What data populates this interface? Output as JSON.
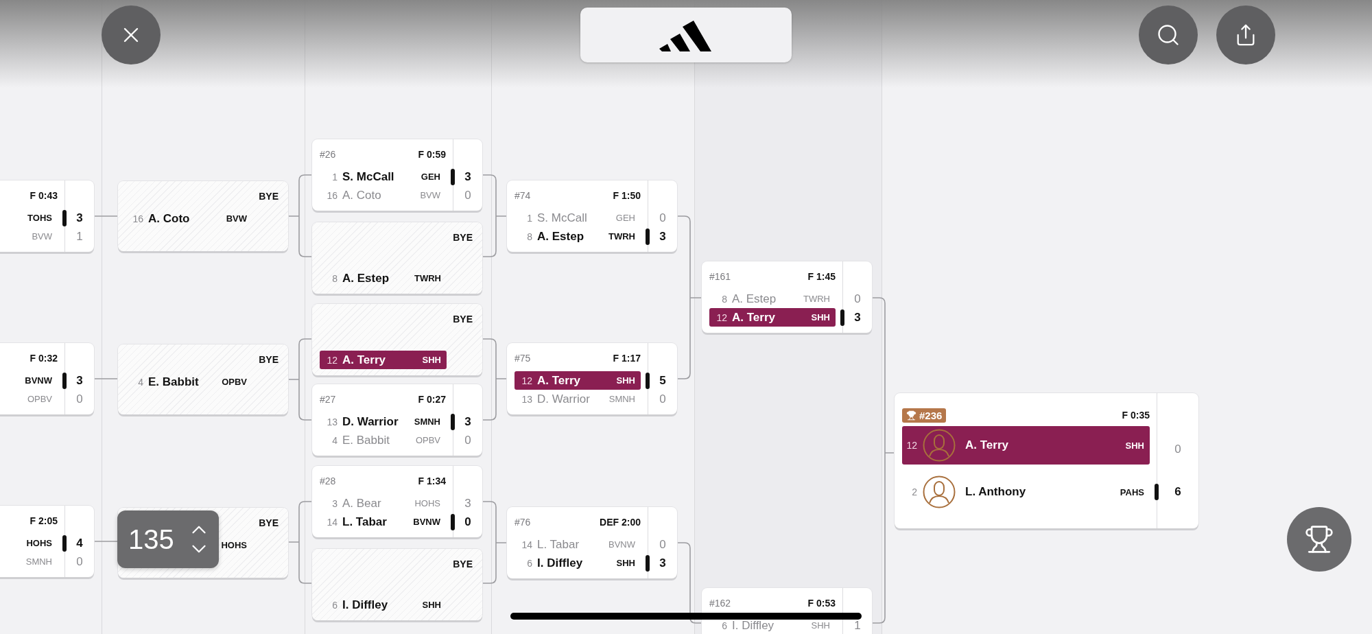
{
  "rounds": [
    {
      "matches": [
        {
          "kind": "match",
          "result": "F 0:43",
          "players": [
            {
              "team": "TOHS",
              "score": "3",
              "winner": true,
              "highlighted": false
            },
            {
              "team": "BVW",
              "score": "1",
              "winner": false,
              "highlighted": false
            }
          ]
        },
        {
          "kind": "match",
          "result": "F 0:32",
          "players": [
            {
              "team": "BVNW",
              "score": "3",
              "winner": true,
              "highlighted": false
            },
            {
              "team": "OPBV",
              "score": "0",
              "winner": false,
              "highlighted": false
            }
          ]
        },
        {
          "kind": "match",
          "result": "F 2:05",
          "players": [
            {
              "team": "HOHS",
              "score": "4",
              "winner": true,
              "highlighted": false
            },
            {
              "team": "SMNH",
              "score": "0",
              "winner": false,
              "highlighted": false
            }
          ]
        }
      ]
    },
    {
      "matches": [
        {
          "kind": "bye",
          "label": "BYE",
          "players": [
            {
              "seed": "16",
              "name": "A. Coto",
              "team": "BVW",
              "highlighted": false
            }
          ]
        },
        {
          "kind": "bye",
          "label": "BYE",
          "players": [
            {
              "seed": "4",
              "name": "E. Babbit",
              "team": "OPBV",
              "highlighted": false
            }
          ]
        },
        {
          "kind": "bye",
          "label": "BYE",
          "players": [
            {
              "team": "HOHS",
              "highlighted": false
            }
          ]
        }
      ]
    },
    {
      "matches": [
        {
          "kind": "match",
          "number": "#26",
          "result": "F 0:59",
          "players": [
            {
              "seed": "1",
              "name": "S. McCall",
              "team": "GEH",
              "score": "3",
              "winner": true,
              "highlighted": false
            },
            {
              "seed": "16",
              "name": "A. Coto",
              "team": "BVW",
              "score": "0",
              "winner": false,
              "highlighted": false
            }
          ]
        },
        {
          "kind": "bye",
          "label": "BYE",
          "players": [
            {
              "seed": "8",
              "name": "A. Estep",
              "team": "TWRH",
              "highlighted": false
            }
          ]
        },
        {
          "kind": "bye",
          "label": "BYE",
          "players": [
            {
              "seed": "12",
              "name": "A. Terry",
              "team": "SHH",
              "highlighted": true
            }
          ]
        },
        {
          "kind": "match",
          "number": "#27",
          "result": "F 0:27",
          "players": [
            {
              "seed": "13",
              "name": "D. Warrior",
              "team": "SMNH",
              "score": "3",
              "winner": true,
              "highlighted": false
            },
            {
              "seed": "4",
              "name": "E. Babbit",
              "team": "OPBV",
              "score": "0",
              "winner": false,
              "highlighted": false
            }
          ]
        },
        {
          "kind": "match",
          "number": "#28",
          "result": "F 1:34",
          "players": [
            {
              "seed": "3",
              "name": "A. Bear",
              "team": "HOHS",
              "score": "3",
              "winner": false,
              "highlighted": false
            },
            {
              "seed": "14",
              "name": "L. Tabar",
              "team": "BVNW",
              "score": "0",
              "winner": true,
              "highlighted": false
            }
          ]
        },
        {
          "kind": "bye",
          "label": "BYE",
          "players": [
            {
              "seed": "6",
              "name": "I. Diffley",
              "team": "SHH",
              "highlighted": false
            }
          ]
        }
      ]
    },
    {
      "matches": [
        {
          "kind": "match",
          "number": "#74",
          "result": "F 1:50",
          "players": [
            {
              "seed": "1",
              "name": "S. McCall",
              "team": "GEH",
              "score": "0",
              "winner": false,
              "highlighted": false
            },
            {
              "seed": "8",
              "name": "A. Estep",
              "team": "TWRH",
              "score": "3",
              "winner": true,
              "highlighted": false
            }
          ]
        },
        {
          "kind": "match",
          "number": "#75",
          "result": "F 1:17",
          "players": [
            {
              "seed": "12",
              "name": "A. Terry",
              "team": "SHH",
              "score": "5",
              "winner": true,
              "highlighted": true
            },
            {
              "seed": "13",
              "name": "D. Warrior",
              "team": "SMNH",
              "score": "0",
              "winner": false,
              "highlighted": false
            }
          ]
        },
        {
          "kind": "match",
          "number": "#76",
          "result": "DEF 2:00",
          "players": [
            {
              "seed": "14",
              "name": "L. Tabar",
              "team": "BVNW",
              "score": "0",
              "winner": false,
              "highlighted": false
            },
            {
              "seed": "6",
              "name": "I. Diffley",
              "team": "SHH",
              "score": "3",
              "winner": true,
              "highlighted": false
            }
          ]
        }
      ]
    },
    {
      "matches": [
        {
          "kind": "match",
          "number": "#161",
          "result": "F 1:45",
          "players": [
            {
              "seed": "8",
              "name": "A. Estep",
              "team": "TWRH",
              "score": "0",
              "winner": false,
              "highlighted": false
            },
            {
              "seed": "12",
              "name": "A. Terry",
              "team": "SHH",
              "score": "3",
              "winner": true,
              "highlighted": true
            }
          ]
        },
        {
          "kind": "match",
          "number": "#162",
          "result": "F 0:53",
          "players": [
            {
              "seed": "6",
              "name": "I. Diffley",
              "team": "SHH",
              "score": "1",
              "winner": false,
              "highlighted": false
            }
          ]
        }
      ]
    }
  ],
  "final": {
    "number": "#236",
    "result": "F 0:35",
    "players": [
      {
        "seed": "12",
        "name": "A. Terry",
        "team": "SHH",
        "score": "0",
        "winner": false,
        "highlighted": true
      },
      {
        "seed": "2",
        "name": "L. Anthony",
        "team": "PAHS",
        "score": "6",
        "winner": true,
        "highlighted": false
      }
    ]
  },
  "stepper": {
    "value": "135"
  }
}
